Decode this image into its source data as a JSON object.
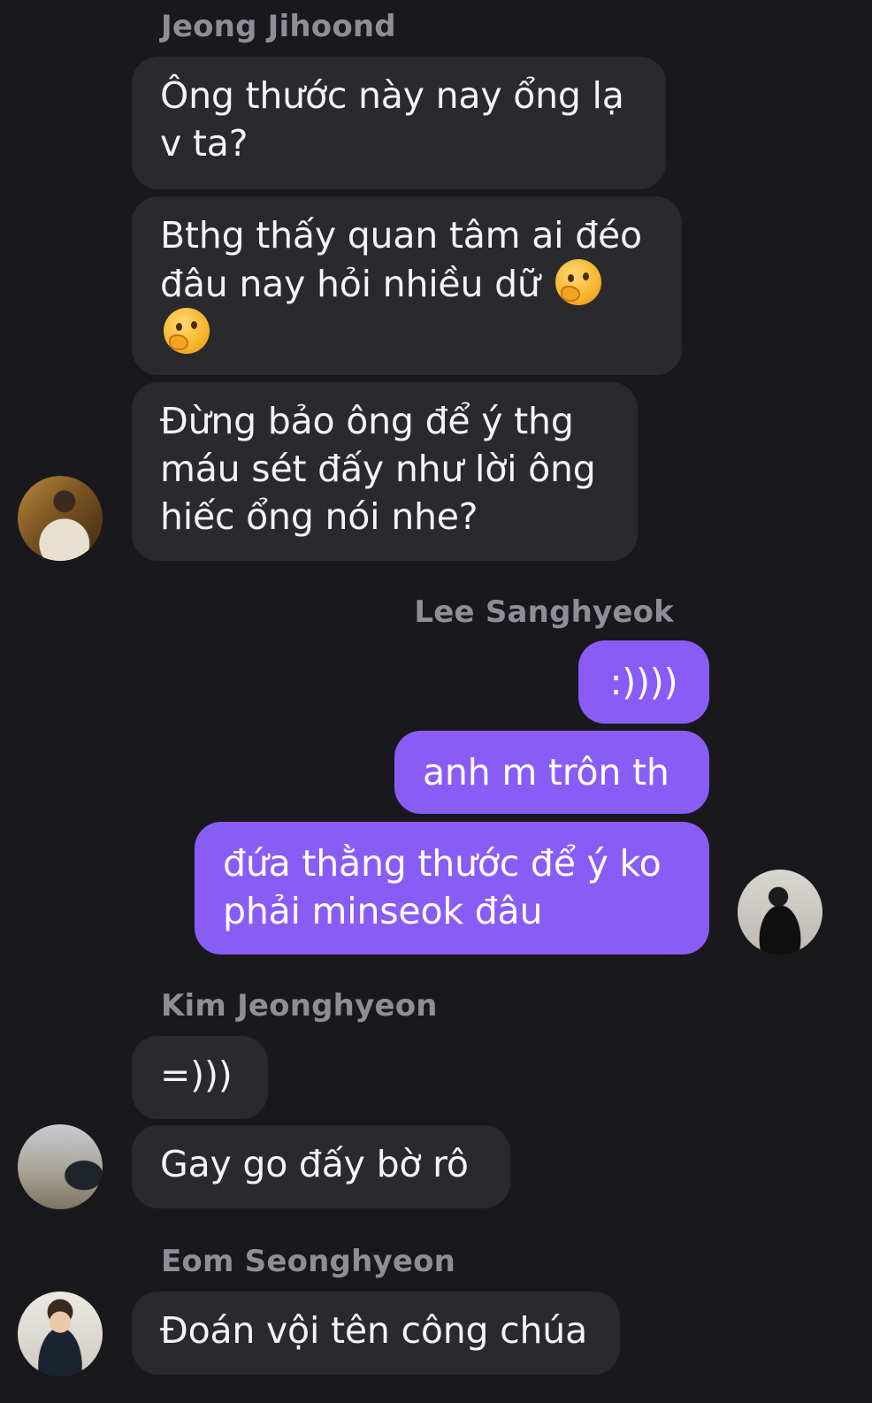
{
  "messages": [
    {
      "sender": "Jeong Jihoond",
      "bubbles": [
        "Ông thước này nay ổng lạ v ta?",
        "Bthg thấy quan tâm ai đéo đâu nay hỏi nhiều dữ",
        "Đừng bảo ông để ý thg máu sét đấy như lời ông hiếc ổng nói nhe?"
      ]
    },
    {
      "sender": "Lee Sanghyeok",
      "bubbles": [
        ":))))",
        "anh m trôn th",
        "đứa thằng thước để ý ko phải minseok đâu"
      ]
    },
    {
      "sender": "Kim Jeonghyeon",
      "bubbles": [
        "=)))",
        "Gay go đấy bờ rô"
      ]
    },
    {
      "sender": "Eom Seonghyeon",
      "bubbles": [
        "Đoán vội tên công chúa"
      ]
    }
  ],
  "emoji": [
    "thinking-face",
    "thinking-face"
  ],
  "colors": {
    "background": "#19181c",
    "incoming_bubble": "#2a2a2e",
    "outgoing_bubble": "#8a5cf6",
    "sender_name": "#8f8d96"
  }
}
